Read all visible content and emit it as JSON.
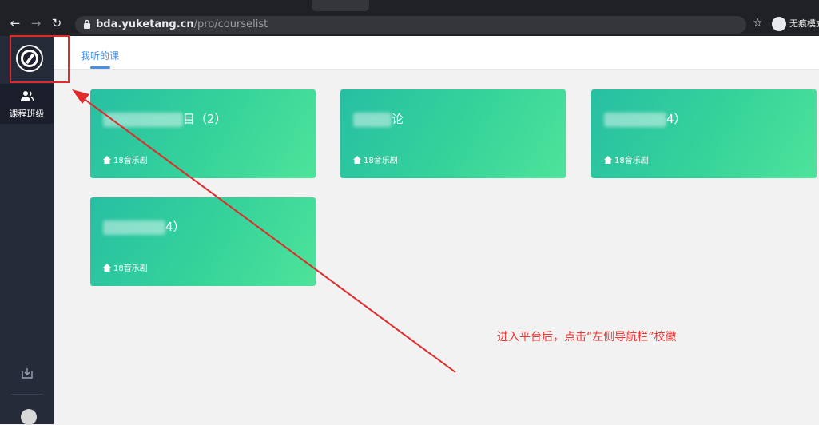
{
  "browser": {
    "url_host": "bda.yuketang.cn",
    "url_path": "/pro/courselist",
    "incognito_label": "无痕模式"
  },
  "sidebar": {
    "class_label": "课程班级"
  },
  "topnav": {
    "tab_label": "我听的课"
  },
  "cards": [
    {
      "title_suffix": "目（2）",
      "meta": "18音乐剧"
    },
    {
      "title_suffix": "论",
      "meta": "18音乐剧"
    },
    {
      "title_suffix": "4）",
      "meta": "18音乐剧"
    },
    {
      "title_suffix": "4）",
      "meta": "18音乐剧"
    }
  ],
  "annotation": {
    "text": "进入平台后，点击“左侧导航栏”校徽",
    "color": "#e33333"
  },
  "colors": {
    "accent": "#4a90e2",
    "sidebar": "#262b3a",
    "card_gradient_start": "#27bfa3",
    "card_gradient_end": "#4ee39a"
  }
}
